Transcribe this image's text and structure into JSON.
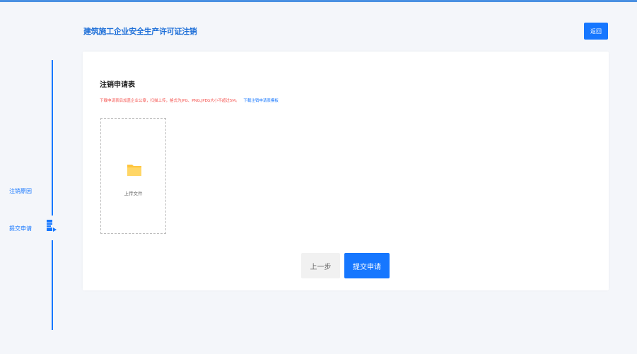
{
  "header": {
    "title": "建筑施工企业安全生产许可证注销",
    "back_label": "返回"
  },
  "steps": [
    {
      "label": "注销原因"
    },
    {
      "label": "提交申请"
    }
  ],
  "form": {
    "title": "注销申请表",
    "hint_text": "下载申请表后加盖企业公章，扫描上传，格式为JPG、PNG,JPEG大小不超过5M。",
    "hint_link": "下载注销申请表模板",
    "upload_label": "上传文件"
  },
  "actions": {
    "prev_label": "上一步",
    "submit_label": "提交申请"
  },
  "colors": {
    "accent": "#1677ff",
    "hint_red": "#f5534f",
    "folder": "#ffc53d"
  }
}
